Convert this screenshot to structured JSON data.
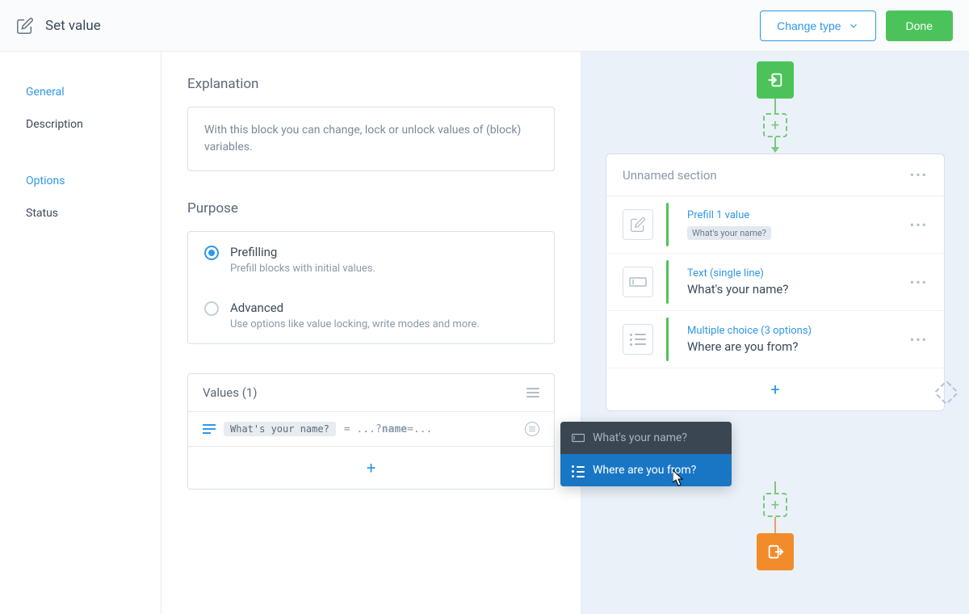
{
  "header": {
    "title": "Set value",
    "change_type": "Change type",
    "done": "Done"
  },
  "sidebar": {
    "items": [
      {
        "label": "General",
        "active": true
      },
      {
        "label": "Description",
        "active": false
      },
      {
        "label": "Options",
        "section": true
      },
      {
        "label": "Status",
        "active": false
      }
    ]
  },
  "content": {
    "explanation": {
      "title": "Explanation",
      "text": "With this block you can change, lock or unlock values of (block) variables."
    },
    "purpose": {
      "title": "Purpose",
      "options": [
        {
          "label": "Prefilling",
          "desc": "Prefill blocks with initial values.",
          "selected": true
        },
        {
          "label": "Advanced",
          "desc": "Use options like value locking, write modes and more.",
          "selected": false
        }
      ]
    },
    "values": {
      "title": "Values (1)",
      "rows": [
        {
          "chip": "What's your name?",
          "expr_before": " = ...?",
          "expr_bold": "name",
          "expr_after": "=..."
        }
      ]
    }
  },
  "canvas": {
    "section_title": "Unnamed section",
    "blocks": [
      {
        "type": "prefill",
        "label": "Prefill 1 value",
        "chip": "What's your name?"
      },
      {
        "type": "text",
        "label": "Text (single line)",
        "title": "What's your name?"
      },
      {
        "type": "choice",
        "label": "Multiple choice (3 options)",
        "title": "Where are you from?"
      }
    ]
  },
  "popup": {
    "items": [
      {
        "label": "What's your name?",
        "selected": false
      },
      {
        "label": "Where are you from?",
        "selected": true
      }
    ]
  }
}
